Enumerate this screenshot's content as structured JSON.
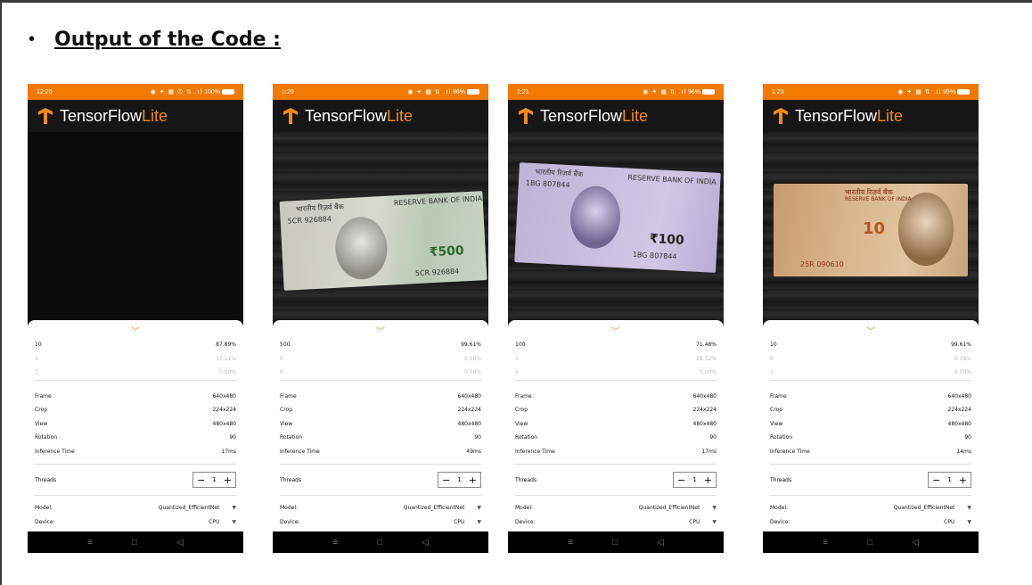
{
  "heading": {
    "bullet": "•",
    "title": "Output of the Code :"
  },
  "brand": {
    "tensor_flow": "TensorFlow",
    "lite": "Lite"
  },
  "labels": {
    "frame": "Frame",
    "crop": "Crop",
    "view": "View",
    "rotation": "Rotation",
    "inference_time": "Inference Time",
    "threads": "Threads",
    "model": "Model:",
    "device": "Device:"
  },
  "nav": {
    "menu": "≡",
    "home": "□",
    "back": "◁"
  },
  "phones": [
    {
      "status_time": "12:26",
      "status_icons": "◉ ✦ ▦ ✆ ⇅ .ıl",
      "battery": "100%",
      "note": "none",
      "results": [
        {
          "label": "10",
          "score": "87.89%"
        },
        {
          "label": "1",
          "score": "12.11%"
        },
        {
          "label": "1",
          "score": "0.00%"
        }
      ],
      "frame": "640x480",
      "crop": "224x224",
      "view": "480x480",
      "rotation": "90",
      "inference_time": "17ms",
      "threads": "1",
      "model": "Quantized_EfficientNet",
      "device": "CPU"
    },
    {
      "status_time": "1:20",
      "status_icons": "◉ ✦ ▦ ⇅ .ıl",
      "battery": "96%",
      "note": "500",
      "results": [
        {
          "label": "500",
          "score": "99.61%"
        },
        {
          "label": "0",
          "score": "0.00%"
        },
        {
          "label": "0",
          "score": "0.00%"
        }
      ],
      "frame": "640x480",
      "crop": "224x224",
      "view": "480x480",
      "rotation": "90",
      "inference_time": "49ms",
      "threads": "1",
      "model": "Quantized_EfficientNet",
      "device": "CPU"
    },
    {
      "status_time": "1:21",
      "status_icons": "◉ ✦ ▦ ⇅ .ıl",
      "battery": "96%",
      "note": "100",
      "results": [
        {
          "label": "100",
          "score": "71.48%"
        },
        {
          "label": "0",
          "score": "28.52%"
        },
        {
          "label": "0",
          "score": "0.00%"
        }
      ],
      "frame": "640x480",
      "crop": "224x224",
      "view": "480x480",
      "rotation": "90",
      "inference_time": "17ms",
      "threads": "1",
      "model": "Quantized_EfficientNet",
      "device": "CPU"
    },
    {
      "status_time": "1:23",
      "status_icons": "◉ ✦ ▦ ⇅ .ıl",
      "battery": "95%",
      "note": "10",
      "results": [
        {
          "label": "10",
          "score": "99.61%"
        },
        {
          "label": "0",
          "score": "0.39%"
        },
        {
          "label": "1",
          "score": "0.00%"
        }
      ],
      "frame": "640x480",
      "crop": "224x224",
      "view": "480x480",
      "rotation": "90",
      "inference_time": "14ms",
      "threads": "1",
      "model": "Quantized_EfficientNet",
      "device": "CPU"
    }
  ],
  "notes": {
    "n500": {
      "hindi": "भारतीय रिज़र्व बैंक",
      "english": "RESERVE BANK OF INDIA",
      "serial": "5CR 926884",
      "value": "₹500"
    },
    "n100": {
      "hindi": "भारतीय रिज़र्व बैंक",
      "english": "RESERVE BANK OF INDIA",
      "serial": "1BG 807844",
      "value": "₹100"
    },
    "n10": {
      "hindi": "भारतीय रिज़र्व बैंक",
      "english": "RESERVE BANK OF INDIA",
      "serial": "25R 090610",
      "value": "10"
    }
  }
}
